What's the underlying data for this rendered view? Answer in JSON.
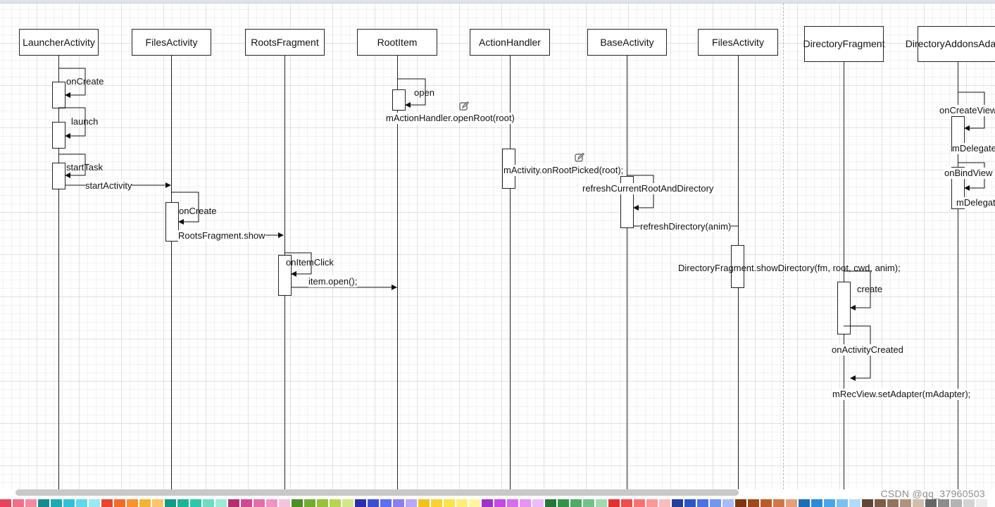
{
  "lifelines": [
    {
      "name": "LauncherActivity"
    },
    {
      "name": "FilesActivity"
    },
    {
      "name": "RootsFragment"
    },
    {
      "name": "RootItem"
    },
    {
      "name": "ActionHandler"
    },
    {
      "name": "BaseActivity"
    },
    {
      "name": "FilesActivity"
    },
    {
      "name": "DirectoryFragment"
    },
    {
      "name": "DirectoryAddonsAdapter"
    }
  ],
  "messages": [
    {
      "label": "onCreate"
    },
    {
      "label": "launch"
    },
    {
      "label": "startTask"
    },
    {
      "label": "startActivity"
    },
    {
      "label": "onCreate"
    },
    {
      "label": "RootsFragment.show"
    },
    {
      "label": "onItemClick"
    },
    {
      "label": "item.open();"
    },
    {
      "label": "open"
    },
    {
      "label": "mActionHandler.openRoot(root)"
    },
    {
      "label": "mActivity.onRootPicked(root);"
    },
    {
      "label": "refreshCurrentRootAndDirectory"
    },
    {
      "label": "refreshDirectory(anim)"
    },
    {
      "label": "DirectoryFragment.showDirectory(fm, root, cwd, anim);"
    },
    {
      "label": "create"
    },
    {
      "label": "onActivityCreated"
    },
    {
      "label": "mRecView.setAdapter(mAdapter);"
    },
    {
      "label": "onCreateView"
    },
    {
      "label": "mDelegate"
    },
    {
      "label": "onBindView"
    },
    {
      "label": "mDelegate"
    }
  ],
  "icons": [
    "edit-icon",
    "edit-icon"
  ],
  "palette": [
    "#e8435a",
    "#ee6f86",
    "#f48aa0",
    "#158b8d",
    "#1fa9b2",
    "#31c1d6",
    "#60d8ea",
    "#9be8f2",
    "#e7452c",
    "#f26a2c",
    "#f7932c",
    "#f5b335",
    "#fbc56d",
    "#139a82",
    "#1cb496",
    "#2dc8ab",
    "#6ddcc1",
    "#9cebd7",
    "#b13170",
    "#d1498f",
    "#e36eaa",
    "#f094c3",
    "#f7c3dc",
    "#4b8f25",
    "#73ab2f",
    "#96c339",
    "#b6d551",
    "#d2e68a",
    "#2d2fa8",
    "#3d4fd1",
    "#5d6ef0",
    "#8a7ff0",
    "#b7a7f6",
    "#f1c21c",
    "#f7d335",
    "#fbe34b",
    "#fdee79",
    "#fef59f",
    "#a132c9",
    "#c349e4",
    "#d46eef",
    "#e394f5",
    "#eebbfa",
    "#26763b",
    "#33924a",
    "#50aa66",
    "#76c08a",
    "#a4d9b0",
    "#e23131",
    "#f14d4d",
    "#f57373",
    "#f99898",
    "#fbbcbc",
    "#243e99",
    "#2d55c4",
    "#4a72e4",
    "#7394ef",
    "#a7bbf6",
    "#7e3610",
    "#9c4818",
    "#b85d29",
    "#d0774a",
    "#e49e7a",
    "#1d6db5",
    "#2b8ad9",
    "#4aa4ea",
    "#7bc0f1",
    "#b3dbf8",
    "#5e4737",
    "#7b5d48",
    "#93735d",
    "#ae9480",
    "#d1bdab",
    "#666666",
    "#8c8c8c",
    "#b3b3b3",
    "#d3d3d3",
    "#ededed"
  ],
  "watermark": "CSDN @qq_37960503"
}
